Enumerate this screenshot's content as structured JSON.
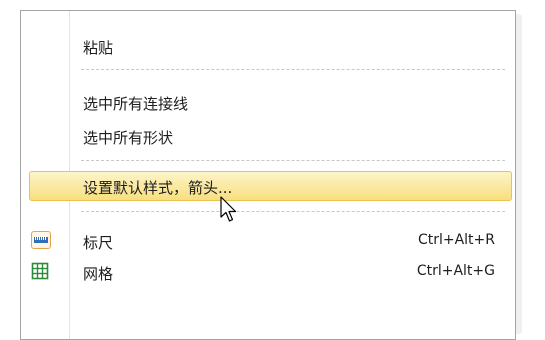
{
  "menu": {
    "items": [
      {
        "label": "粘贴"
      },
      {
        "label": "选中所有连接线"
      },
      {
        "label": "选中所有形状"
      },
      {
        "label": "设置默认样式，箭头..."
      },
      {
        "label": "标尺",
        "shortcut": "Ctrl+Alt+R",
        "icon": "ruler-icon"
      },
      {
        "label": "网格",
        "shortcut": "Ctrl+Alt+G",
        "icon": "grid-icon"
      }
    ]
  },
  "colors": {
    "highlight_top": "#fdf4c8",
    "highlight_bottom": "#f8df7e",
    "highlight_border": "#e9c24f",
    "ruler_icon": "#2f6fb6",
    "grid_icon": "#2e8b3a"
  }
}
